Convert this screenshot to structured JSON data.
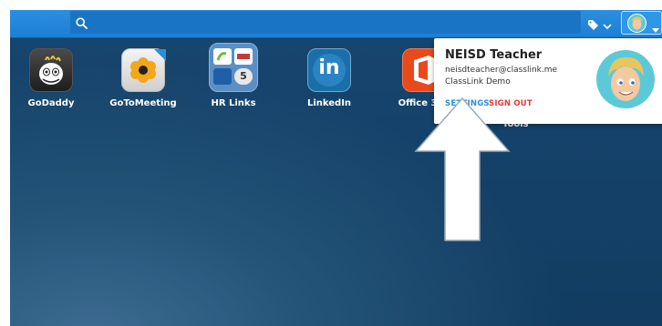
{
  "search": {
    "value": "",
    "placeholder": ""
  },
  "apps": [
    {
      "label": "GoDaddy"
    },
    {
      "label": "GoToMeeting"
    },
    {
      "label": "HR Links",
      "sub_badge": "5"
    },
    {
      "label": "LinkedIn",
      "logo_text": "in"
    },
    {
      "label": "Office 365"
    },
    {
      "label": "Tools"
    }
  ],
  "user_menu": {
    "name": "NEISD Teacher",
    "email": "neisdteacher@classlink.me",
    "org": "ClassLink Demo",
    "settings_label": "SETTINGS",
    "signout_label": "SIGN OUT"
  },
  "colors": {
    "topbar": "#1e7fd4",
    "background": "#123c62",
    "settings": "#2a8fd6",
    "signout": "#e03a3a"
  },
  "icons": [
    "search-icon",
    "tag-icon",
    "chevron-down-icon",
    "avatar",
    "arrow-pointer-icon"
  ]
}
